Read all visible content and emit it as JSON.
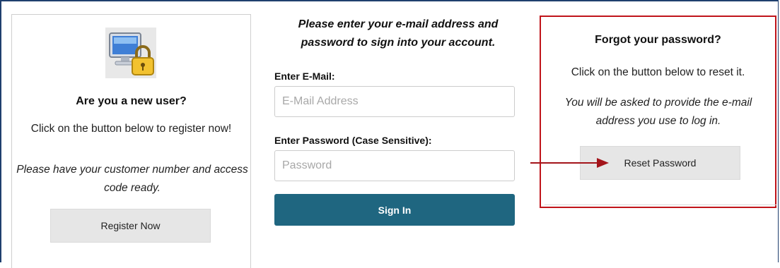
{
  "new_user": {
    "icon": "computer-lock-icon",
    "title": "Are you a new user?",
    "description": "Click on the button below to register now!",
    "note": "Please have your customer number and access code ready.",
    "register_label": "Register Now"
  },
  "sign_in": {
    "heading": "Please enter your e-mail address and password to sign into your account.",
    "email_label": "Enter E-Mail:",
    "email_placeholder": "E-Mail Address",
    "email_value": "",
    "password_label": "Enter Password (Case Sensitive):",
    "password_placeholder": "Password",
    "password_value": "",
    "submit_label": "Sign In"
  },
  "forgot_password": {
    "title": "Forgot your password?",
    "description": "Click on the button below to reset it.",
    "note": "You will be asked to provide the e-mail address you use to log in.",
    "reset_label": "Reset Password",
    "arrow_icon": "arrow-right-icon"
  },
  "colors": {
    "primary_button": "#1f6680",
    "highlight_border": "#c0141a",
    "frame_border": "#1f3f6e",
    "secondary_button": "#e6e6e6"
  }
}
